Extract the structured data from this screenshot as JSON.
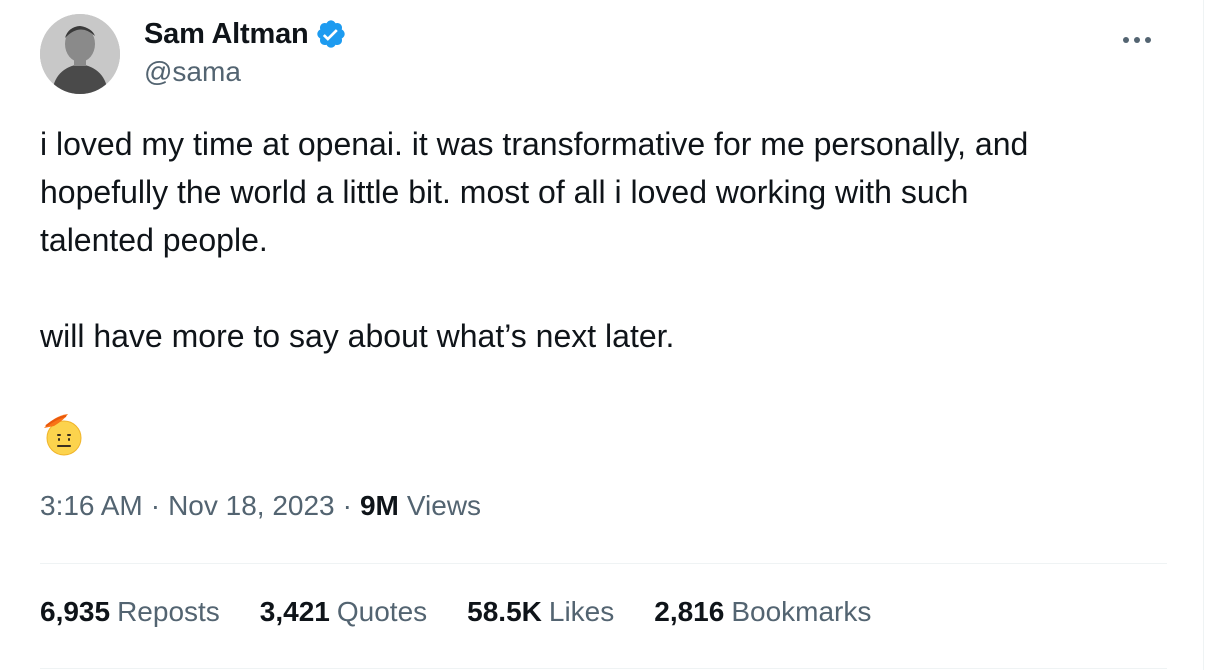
{
  "author": {
    "display_name": "Sam Altman",
    "handle": "@sama",
    "verified": true
  },
  "tweet": {
    "text": "i loved my time at openai. it was transformative for me personally, and\nhopefully the world a little bit. most of all i loved working with such\ntalented people.\n\nwill have more to say about what’s next later.",
    "emoji": "🫡"
  },
  "meta": {
    "time": "3:16 AM",
    "separator": "·",
    "date": "Nov 18, 2023",
    "views_count": "9M",
    "views_label": "Views"
  },
  "stats": {
    "reposts": {
      "count": "6,935",
      "label": "Reposts"
    },
    "quotes": {
      "count": "3,421",
      "label": "Quotes"
    },
    "likes": {
      "count": "58.5K",
      "label": "Likes"
    },
    "bookmarks": {
      "count": "2,816",
      "label": "Bookmarks"
    }
  },
  "icons": {
    "verified_badge": "verified-badge-icon",
    "more": "more-horizontal-icon",
    "emoji": "saluting-face-emoji"
  },
  "colors": {
    "text_primary": "#0f1419",
    "text_secondary": "#536471",
    "verified_blue": "#1d9bf0",
    "divider": "#eff3f4"
  }
}
